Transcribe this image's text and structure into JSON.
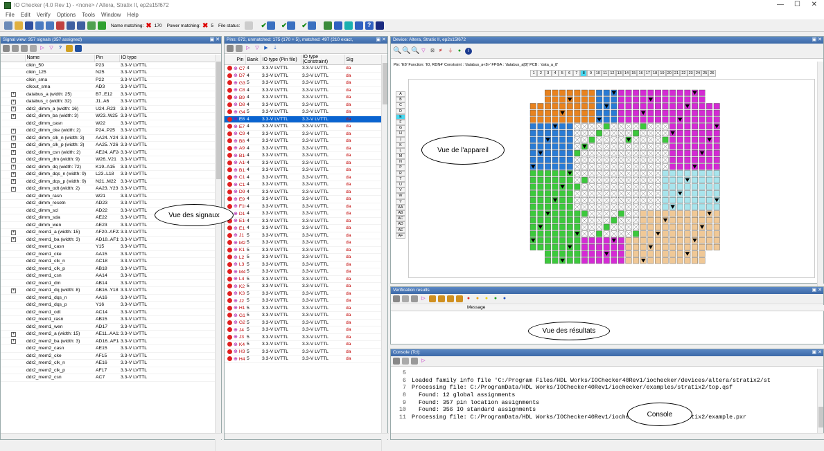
{
  "window": {
    "title": "IO Checker (4.0 Rev 1) - <none> / Altera, Stratix II, ep2s15f672"
  },
  "menu": [
    "File",
    "Edit",
    "Verify",
    "Options",
    "Tools",
    "Window",
    "Help"
  ],
  "toolbar": {
    "name_matching_label": "Name matching:",
    "name_matching_count": "170",
    "power_matching_label": "Power matching:",
    "power_matching_count": "5",
    "file_status_label": "File status:"
  },
  "signal_view": {
    "header": "Signal view: 357 signals (357 assigned)",
    "columns": [
      "Name",
      "Pin",
      "IO type"
    ],
    "rows": [
      {
        "exp": false,
        "name": "clkin_50",
        "pin": "P23",
        "io": "3.3-V LVTTL"
      },
      {
        "exp": false,
        "name": "clkin_125",
        "pin": "N25",
        "io": "3.3-V LVTTL"
      },
      {
        "exp": false,
        "name": "clkin_sma",
        "pin": "P22",
        "io": "3.3-V LVTTL"
      },
      {
        "exp": false,
        "name": "clkout_sma",
        "pin": "AD3",
        "io": "3.3-V LVTTL"
      },
      {
        "exp": true,
        "name": "databus_a (width: 25)",
        "pin": "B7..E12",
        "io": "3.3-V LVTTL"
      },
      {
        "exp": true,
        "name": "databus_c (width: 32)",
        "pin": "J1..A6",
        "io": "3.3-V LVTTL"
      },
      {
        "exp": true,
        "name": "ddr2_dimm_a (width: 16)",
        "pin": "U24..R23",
        "io": "3.3-V LVTTL"
      },
      {
        "exp": true,
        "name": "ddr2_dimm_ba (width: 3)",
        "pin": "W23..W25",
        "io": "3.3-V LVTTL"
      },
      {
        "exp": false,
        "name": "ddr2_dimm_casn",
        "pin": "W22",
        "io": "3.3-V LVTTL"
      },
      {
        "exp": true,
        "name": "ddr2_dimm_cke (width: 2)",
        "pin": "P24..P25",
        "io": "3.3-V LVTTL"
      },
      {
        "exp": true,
        "name": "ddr2_dimm_clk_n (width: 3)",
        "pin": "AA24..Y24",
        "io": "3.3-V LVTTL"
      },
      {
        "exp": true,
        "name": "ddr2_dimm_clk_p (width: 3)",
        "pin": "AA25..Y26",
        "io": "3.3-V LVTTL"
      },
      {
        "exp": true,
        "name": "ddr2_dimm_csn (width: 2)",
        "pin": "AE24..AF24",
        "io": "3.3-V LVTTL"
      },
      {
        "exp": true,
        "name": "ddr2_dimm_dm (width: 9)",
        "pin": "W26..V21",
        "io": "3.3-V LVTTL"
      },
      {
        "exp": true,
        "name": "ddr2_dimm_dq (width: 72)",
        "pin": "K19..A15",
        "io": "3.3-V LVTTL"
      },
      {
        "exp": true,
        "name": "ddr2_dimm_dqs_n (width: 9)",
        "pin": "L23..L18",
        "io": "3.3-V LVTTL"
      },
      {
        "exp": true,
        "name": "ddr2_dimm_dqs_p (width: 9)",
        "pin": "N21..M22",
        "io": "3.3-V LVTTL"
      },
      {
        "exp": true,
        "name": "ddr2_dimm_odt (width: 2)",
        "pin": "AA23..Y23",
        "io": "3.3-V LVTTL"
      },
      {
        "exp": false,
        "name": "ddr2_dimm_rasn",
        "pin": "W21",
        "io": "3.3-V LVTTL"
      },
      {
        "exp": false,
        "name": "ddr2_dimm_resetn",
        "pin": "AD23",
        "io": "3.3-V LVTTL"
      },
      {
        "exp": false,
        "name": "ddr2_dimm_scl",
        "pin": "AD22",
        "io": "3.3-V LVTTL"
      },
      {
        "exp": false,
        "name": "ddr2_dimm_sda",
        "pin": "AE22",
        "io": "3.3-V LVTTL"
      },
      {
        "exp": false,
        "name": "ddr2_dimm_wen",
        "pin": "AE23",
        "io": "3.3-V LVTTL"
      },
      {
        "exp": true,
        "name": "ddr2_mem1_a (width: 15)",
        "pin": "AF20..AF22",
        "io": "3.3-V LVTTL"
      },
      {
        "exp": true,
        "name": "ddr2_mem1_ba (width: 3)",
        "pin": "AD18..AF19",
        "io": "3.3-V LVTTL"
      },
      {
        "exp": false,
        "name": "ddr2_mem1_casn",
        "pin": "Y15",
        "io": "3.3-V LVTTL"
      },
      {
        "exp": false,
        "name": "ddr2_mem1_cke",
        "pin": "AA15",
        "io": "3.3-V LVTTL"
      },
      {
        "exp": false,
        "name": "ddr2_mem1_clk_n",
        "pin": "AC18",
        "io": "3.3-V LVTTL"
      },
      {
        "exp": false,
        "name": "ddr2_mem1_clk_p",
        "pin": "AB18",
        "io": "3.3-V LVTTL"
      },
      {
        "exp": false,
        "name": "ddr2_mem1_csn",
        "pin": "AA14",
        "io": "3.3-V LVTTL"
      },
      {
        "exp": false,
        "name": "ddr2_mem1_dm",
        "pin": "AB14",
        "io": "3.3-V LVTTL"
      },
      {
        "exp": true,
        "name": "ddr2_mem1_dq (width: 8)",
        "pin": "AB16..Y18",
        "io": "3.3-V LVTTL"
      },
      {
        "exp": false,
        "name": "ddr2_mem1_dqs_n",
        "pin": "AA16",
        "io": "3.3-V LVTTL"
      },
      {
        "exp": false,
        "name": "ddr2_mem1_dqs_p",
        "pin": "Y16",
        "io": "3.3-V LVTTL"
      },
      {
        "exp": false,
        "name": "ddr2_mem1_odt",
        "pin": "AC14",
        "io": "3.3-V LVTTL"
      },
      {
        "exp": false,
        "name": "ddr2_mem1_rasn",
        "pin": "AB15",
        "io": "3.3-V LVTTL"
      },
      {
        "exp": false,
        "name": "ddr2_mem1_wen",
        "pin": "AD17",
        "io": "3.3-V LVTTL"
      },
      {
        "exp": true,
        "name": "ddr2_mem2_a (width: 15)",
        "pin": "AE11..AA12",
        "io": "3.3-V LVTTL"
      },
      {
        "exp": true,
        "name": "ddr2_mem2_ba (width: 3)",
        "pin": "AD16..AF18",
        "io": "3.3-V LVTTL"
      },
      {
        "exp": false,
        "name": "ddr2_mem2_casn",
        "pin": "AE15",
        "io": "3.3-V LVTTL"
      },
      {
        "exp": false,
        "name": "ddr2_mem2_cke",
        "pin": "AF15",
        "io": "3.3-V LVTTL"
      },
      {
        "exp": false,
        "name": "ddr2_mem2_clk_n",
        "pin": "AE16",
        "io": "3.3-V LVTTL"
      },
      {
        "exp": false,
        "name": "ddr2_mem2_clk_p",
        "pin": "AF17",
        "io": "3.3-V LVTTL"
      },
      {
        "exp": false,
        "name": "ddr2_mem2_csn",
        "pin": "AC7",
        "io": "3.3-V LVTTL"
      }
    ]
  },
  "pin_view": {
    "header": "Pins: 672, unmatched: 175 (170 + 5), matched: 497 (210 exact,",
    "columns": [
      "Pin",
      "Bank",
      "IO type (Pin file)",
      "IO type (Constraint)",
      "Sig"
    ],
    "rows": [
      [
        "C7",
        "4"
      ],
      [
        "D7",
        "4"
      ],
      [
        "G3",
        "5"
      ],
      [
        "C8",
        "4"
      ],
      [
        "B9",
        "4"
      ],
      [
        "D8",
        "4"
      ],
      [
        "G4",
        "5"
      ],
      [
        "E8",
        "4"
      ],
      [
        "E7",
        "4"
      ],
      [
        "C9",
        "4"
      ],
      [
        "B8",
        "4"
      ],
      [
        "A9",
        "4"
      ],
      [
        "B10",
        "4"
      ],
      [
        "A10",
        "4"
      ],
      [
        "B11",
        "4"
      ],
      [
        "C10",
        "4"
      ],
      [
        "C11",
        "4"
      ],
      [
        "D9",
        "4"
      ],
      [
        "E9",
        "4"
      ],
      [
        "F10",
        "4"
      ],
      [
        "D10",
        "4"
      ],
      [
        "E10",
        "4"
      ],
      [
        "E12",
        "4"
      ],
      [
        "J1",
        "5"
      ],
      [
        "M2",
        "5"
      ],
      [
        "K1",
        "5"
      ],
      [
        "L2",
        "5"
      ],
      [
        "L3",
        "5"
      ],
      [
        "M4",
        "5"
      ],
      [
        "L4",
        "5"
      ],
      [
        "K2",
        "5"
      ],
      [
        "K3",
        "5"
      ],
      [
        "J2",
        "5"
      ],
      [
        "H1",
        "5"
      ],
      [
        "G1",
        "5"
      ],
      [
        "G2",
        "5"
      ],
      [
        "J4",
        "5"
      ],
      [
        "J3",
        "5"
      ],
      [
        "K4",
        "5"
      ],
      [
        "H3",
        "5"
      ],
      [
        "H4",
        "5"
      ]
    ],
    "io_pin": "3.3-V LVTTL",
    "io_con": "3.3-V LVTTL",
    "sig": "da",
    "selected_index": 7
  },
  "device_view": {
    "header": "Device: Altera, Stratix II, ep2s15f672",
    "info": "Pin: 'E8' Function: 'IO, RDN4' Constraint : 'databus_a<8>' FPGA : 'databus_a[8]' PCB : 'data_a_8'",
    "cols": [
      "1",
      "2",
      "3",
      "4",
      "5",
      "6",
      "7",
      "8",
      "9",
      "10",
      "11",
      "12",
      "13",
      "14",
      "15",
      "16",
      "17",
      "18",
      "19",
      "20",
      "21",
      "22",
      "23",
      "24",
      "25",
      "26"
    ],
    "rows": [
      "A",
      "B",
      "C",
      "D",
      "E",
      "F",
      "G",
      "H",
      "J",
      "K",
      "L",
      "M",
      "N",
      "P",
      "R",
      "T",
      "U",
      "V",
      "W",
      "Y",
      "AA",
      "AB",
      "AC",
      "AD",
      "AE",
      "AF"
    ]
  },
  "verification": {
    "header": "Verification results",
    "col": "Message"
  },
  "console": {
    "header": "Console (Tcl):",
    "lines": [
      {
        "n": "5",
        "t": ""
      },
      {
        "n": "6",
        "t": "Loaded family info file 'C:/Program Files/HDL Works/IOChecker40Rev1/iochecker/devices/altera/stratix2/st"
      },
      {
        "n": "7",
        "t": "Processing file: C:/ProgramData/HDL Works/IOChecker40Rev1/iochecker/examples/stratix2/top.qsf"
      },
      {
        "n": "8",
        "t": "  Found: 12 global assignments"
      },
      {
        "n": "9",
        "t": "  Found: 357 pin location assignments"
      },
      {
        "n": "10",
        "t": "  Found: 356 IO standard assignments"
      },
      {
        "n": "11",
        "t": "Processing file: C:/ProgramData/HDL Works/IOChecker40Rev1/iochecker/examples/stratix2/example.pxr"
      }
    ]
  },
  "annotations": {
    "signals": "Vue des signaux",
    "device": "Vue de l'appareil",
    "results": "Vue des résultats",
    "console": "Console"
  },
  "colors": {
    "header": "#3c69a8",
    "selection": "#0a64d0",
    "orange": "#e8821e",
    "blue": "#2a7bd4",
    "magenta": "#d42ad4",
    "green": "#3cc83c",
    "cyan": "#a8e4ec",
    "tan": "#f0c896"
  }
}
